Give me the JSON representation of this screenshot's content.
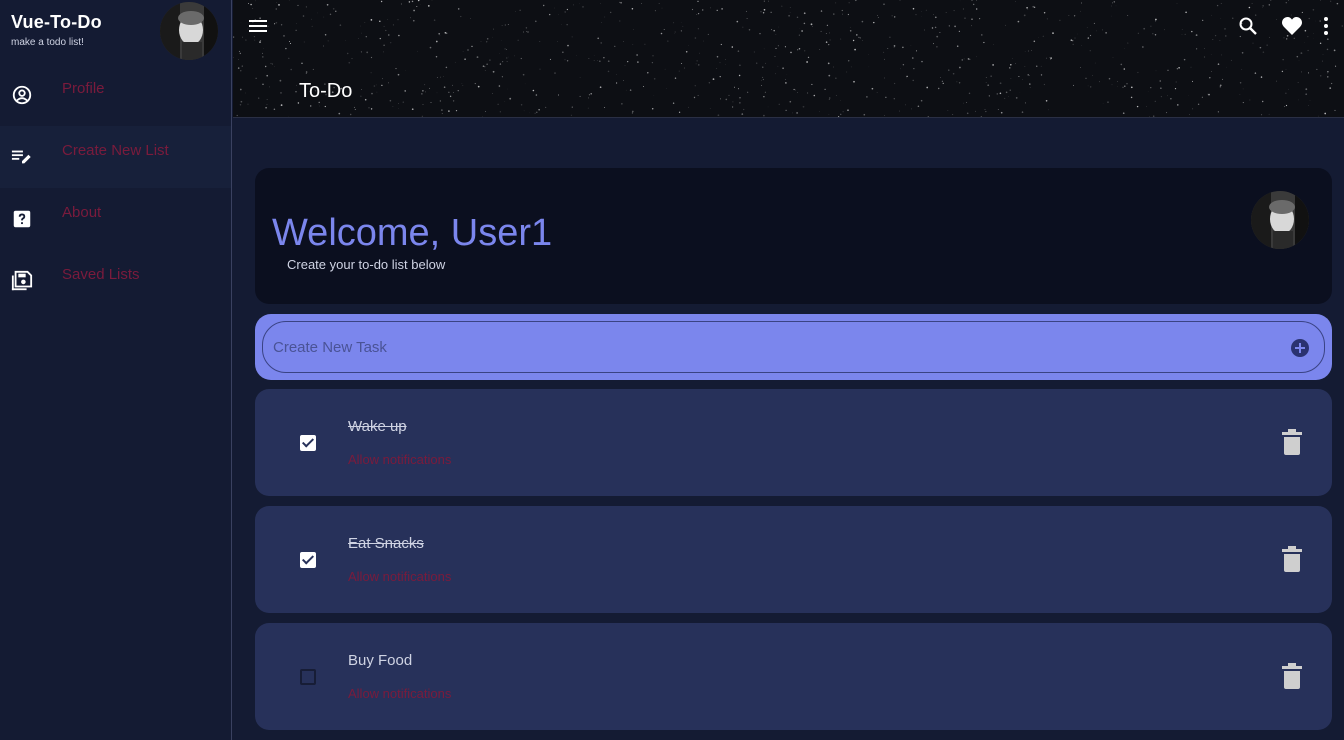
{
  "app": {
    "title": "Vue-To-Do",
    "subtitle": "make a todo list!"
  },
  "sidebar": {
    "items": [
      {
        "label": "Profile",
        "icon": "account-circle-icon"
      },
      {
        "label": "Create New List",
        "icon": "playlist-edit-icon"
      },
      {
        "label": "About",
        "icon": "help-box-icon"
      },
      {
        "label": "Saved Lists",
        "icon": "content-save-icon"
      }
    ]
  },
  "header": {
    "title": "To-Do",
    "actions": [
      "search-icon",
      "heart-icon",
      "dots-vertical-icon"
    ]
  },
  "welcome": {
    "title": "Welcome, User1",
    "subtitle": "Create your to-do list below"
  },
  "new_task": {
    "placeholder": "Create New Task",
    "value": ""
  },
  "tasks": [
    {
      "title": "Wake up",
      "subtitle": "Allow notifications",
      "done": true
    },
    {
      "title": "Eat Snacks",
      "subtitle": "Allow notifications",
      "done": true
    },
    {
      "title": "Buy Food",
      "subtitle": "Allow notifications",
      "done": false
    }
  ],
  "colors": {
    "accent": "#7b86ed",
    "background": "#141b33",
    "card": "#27315a",
    "muted_link": "#7a1b3c"
  }
}
